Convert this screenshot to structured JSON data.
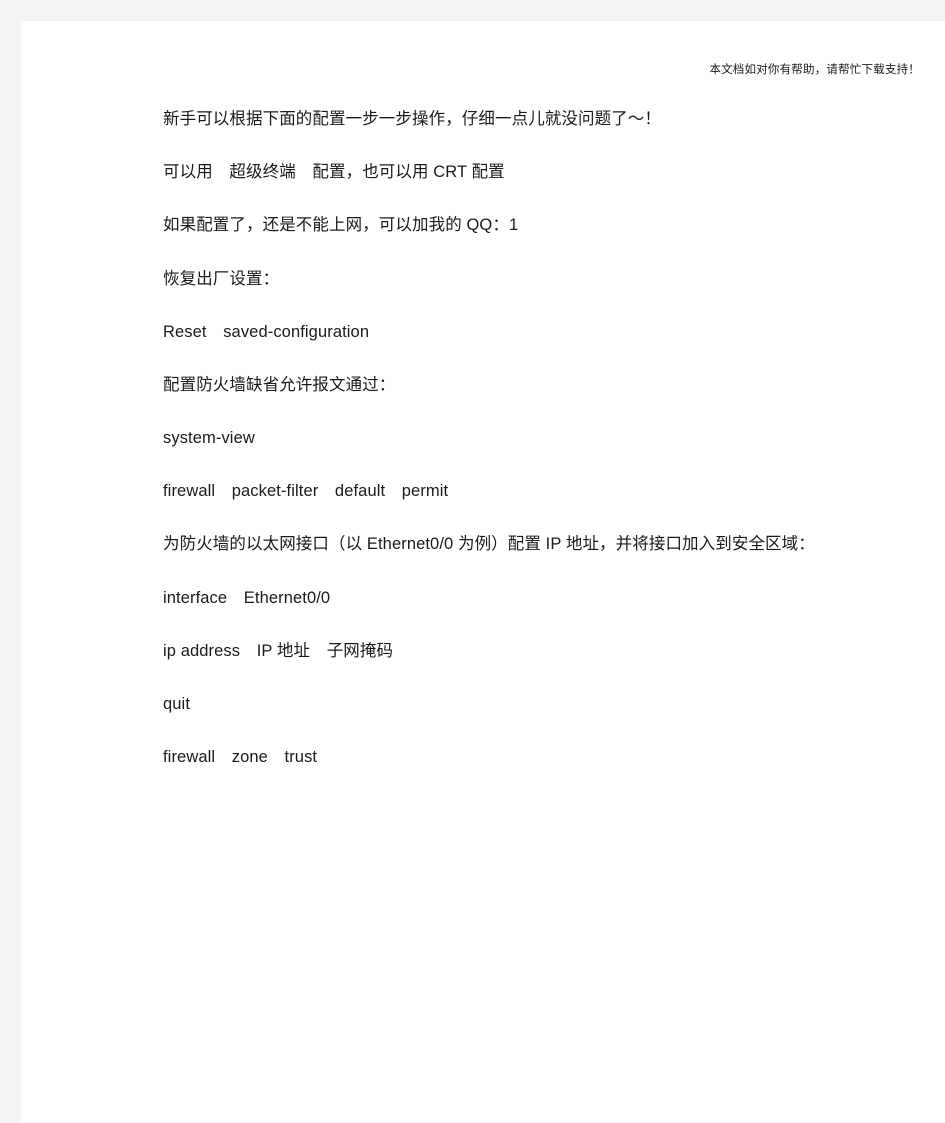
{
  "page": {
    "header_note": "本文档如对你有帮助，请帮忙下载支持！",
    "background_color": "#ffffff",
    "outer_margin_color": "#f4f4f5",
    "text_color": "#1a1a1a"
  },
  "content": {
    "paragraphs": [
      {
        "id": "intro",
        "text": "新手可以根据下面的配置一步一步操作，仔细一点儿就没问题了～！"
      },
      {
        "id": "tools",
        "text": "可以用　超级终端　配置，也可以用 CRT 配置"
      },
      {
        "id": "contact",
        "text": "如果配置了，还是不能上网，可以加我的 QQ：1"
      },
      {
        "id": "restore-heading",
        "text": "恢复出厂设置："
      },
      {
        "id": "cmd-reset",
        "text": "Reset　saved-configuration"
      },
      {
        "id": "firewall-default-heading",
        "text": "配置防火墙缺省允许报文通过："
      },
      {
        "id": "cmd-system-view",
        "text": "system-view"
      },
      {
        "id": "cmd-packet-filter",
        "text": "firewall　packet-filter　default　permit"
      },
      {
        "id": "interface-heading",
        "text": "为防火墙的以太网接口（以 Ethernet0/0 为例）配置 IP 地址，并将接口加入到安全区域："
      },
      {
        "id": "cmd-interface",
        "text": "interface　Ethernet0/0"
      },
      {
        "id": "cmd-ip-address",
        "text": "ip address　IP 地址　子网掩码"
      },
      {
        "id": "cmd-quit",
        "text": "quit"
      },
      {
        "id": "cmd-firewall-zone",
        "text": "firewall　zone　trust"
      }
    ]
  }
}
